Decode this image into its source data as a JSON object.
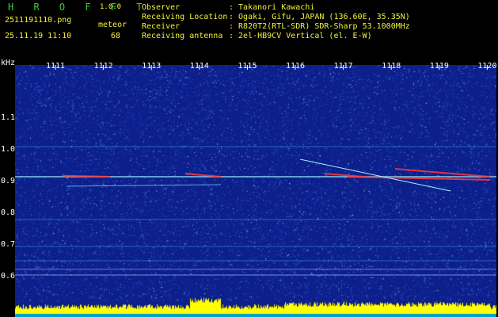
{
  "header": {
    "app_title": "H R O F F T",
    "version": "1.0.0",
    "filename": "2511191110.png",
    "datetime": "25.11.19 11:10",
    "event_type": "meteor",
    "event_count": "68",
    "info": [
      {
        "key": "Observer",
        "value": ": Takanori Kawachi"
      },
      {
        "key": "Receiving Location",
        "value": ": Ogaki, Gifu, JAPAN (136.60E, 35.35N)"
      },
      {
        "key": "Receiver",
        "value": ": R820T2(RTL-SDR) SDR-Sharp 53.1000MHz"
      },
      {
        "key": "Receiving antenna",
        "value": ": 2el-HB9CV Vertical (el. E-W)"
      }
    ]
  },
  "chart_data": {
    "type": "heatmap",
    "ylabel": "kHz",
    "x_ticks": [
      "1111",
      "1112",
      "1113",
      "1114",
      "1115",
      "1116",
      "1117",
      "1118",
      "1119",
      "1120"
    ],
    "y_ticks": [
      "1.1",
      "1.0",
      "0.9",
      "0.8",
      "0.7",
      "0.6"
    ],
    "ylim": [
      0.6,
      1.18
    ],
    "colors": {
      "background": "#0d1f8a",
      "noise": "#5aa0ff",
      "signal": "#ff3a3a",
      "power": "#ffff00"
    }
  }
}
